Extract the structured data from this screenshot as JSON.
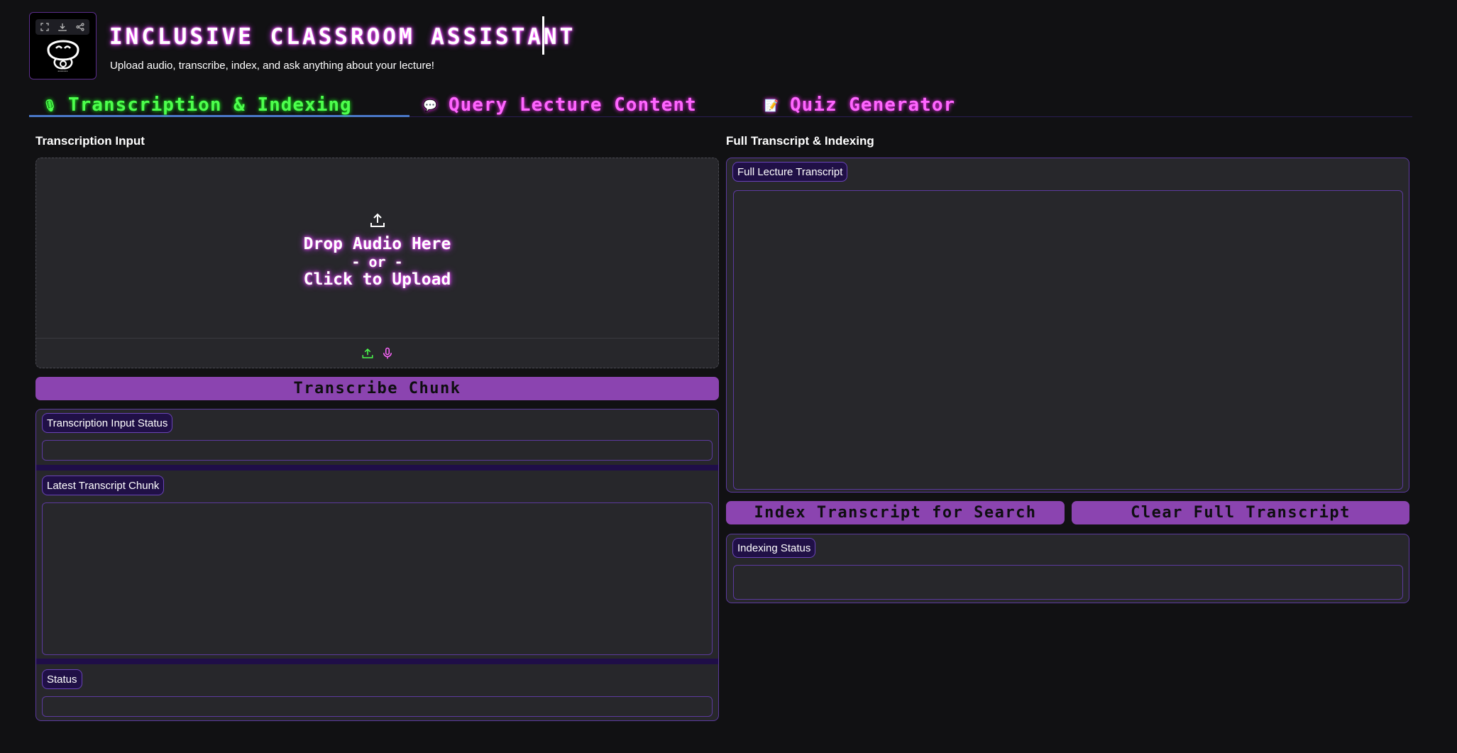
{
  "header": {
    "title": "INCLUSIVE CLASSROOM ASSISTANT",
    "subtitle": "Upload audio, transcribe, index, and ask anything about your lecture!",
    "logo_icons": [
      "fullscreen-icon",
      "download-icon",
      "share-icon"
    ]
  },
  "tabs": [
    {
      "label": "Transcription & Indexing",
      "icon": "🎙",
      "active": true
    },
    {
      "label": "Query Lecture Content",
      "icon": "💬",
      "active": false
    },
    {
      "label": "Quiz Generator",
      "icon": "📝",
      "active": false
    }
  ],
  "left": {
    "section_label": "Transcription Input",
    "upload": {
      "line1": "Drop Audio Here",
      "line2": "- or -",
      "line3": "Click to Upload"
    },
    "transcribe_button": "Transcribe Chunk",
    "input_status_label": "Transcription Input Status",
    "latest_chunk_label": "Latest Transcript Chunk",
    "status_label": "Status"
  },
  "right": {
    "section_label": "Full Transcript & Indexing",
    "transcript_label": "Full Lecture Transcript",
    "index_button": "Index Transcript for Search",
    "clear_button": "Clear Full Transcript",
    "indexing_status_label": "Indexing Status"
  },
  "colors": {
    "background": "#111113",
    "panel": "#27272b",
    "accent_purple": "#8b44b0",
    "neon_green": "#4dff4d",
    "neon_pink": "#ff66ff"
  }
}
